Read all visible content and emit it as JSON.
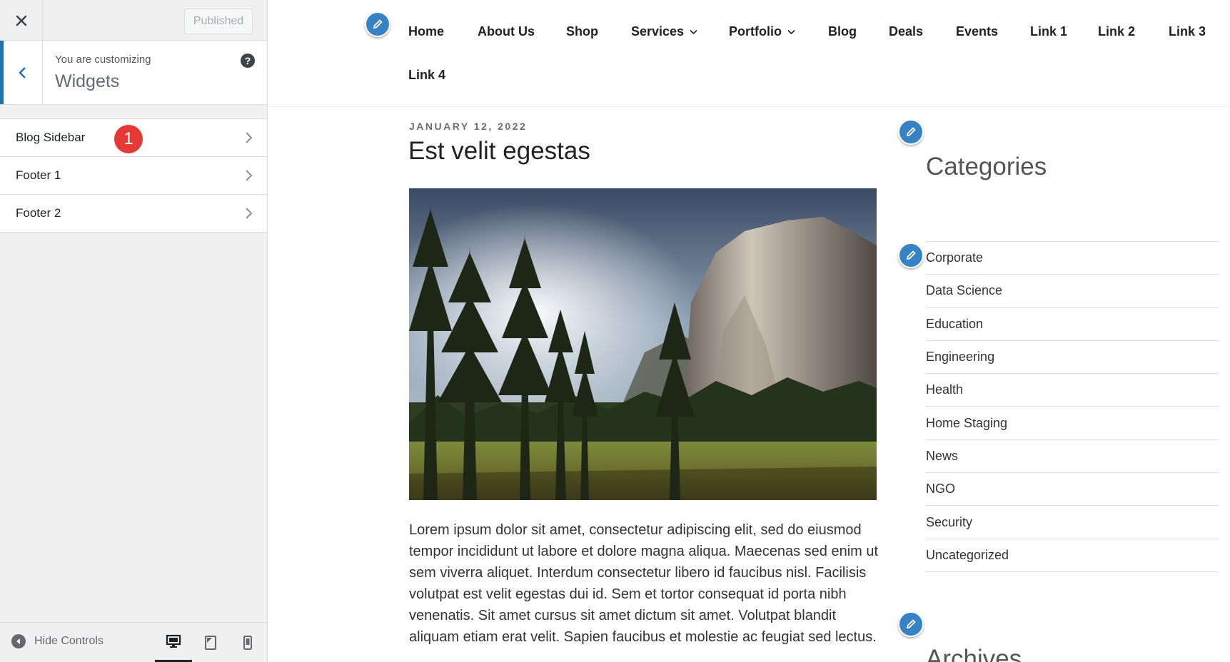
{
  "customizer": {
    "published_label": "Published",
    "action_label": "You are customizing",
    "panel_title": "Widgets",
    "help_glyph": "?",
    "sections": [
      {
        "label": "Blog Sidebar",
        "badge": "1"
      },
      {
        "label": "Footer 1"
      },
      {
        "label": "Footer 2"
      }
    ],
    "hide_controls_label": "Hide Controls",
    "active_device": "desktop",
    "accent_color": "#2271b1",
    "badge_color": "#e53935"
  },
  "nav": {
    "items": [
      {
        "label": "Home"
      },
      {
        "label": "About Us"
      },
      {
        "label": "Shop"
      },
      {
        "label": "Services",
        "has_submenu": true
      },
      {
        "label": "Portfolio",
        "has_submenu": true
      },
      {
        "label": "Blog"
      },
      {
        "label": "Deals"
      },
      {
        "label": "Events"
      },
      {
        "label": "Link 1"
      },
      {
        "label": "Link 2"
      },
      {
        "label": "Link 3"
      },
      {
        "label": "Link 4"
      }
    ]
  },
  "post": {
    "date": "JANUARY 12, 2022",
    "title": "Est velit egestas",
    "body": "Lorem ipsum dolor sit amet, consectetur adipiscing elit, sed do eiusmod tempor incididunt ut labore et dolore magna aliqua. Maecenas sed enim ut sem viverra aliquet. Interdum consectetur libero id faucibus nisl. Facilisis volutpat est velit egestas dui id. Sem et tortor consequat id porta nibh venenatis. Sit amet cursus sit amet dictum sit amet. Volutpat blandit aliquam etiam erat velit. Sapien faucibus et molestie ac feugiat sed lectus."
  },
  "sidebar": {
    "categories_title": "Categories",
    "categories": [
      "Corporate",
      "Data Science",
      "Education",
      "Engineering",
      "Health",
      "Home Staging",
      "News",
      "NGO",
      "Security",
      "Uncategorized"
    ],
    "archives_title": "Archives"
  }
}
